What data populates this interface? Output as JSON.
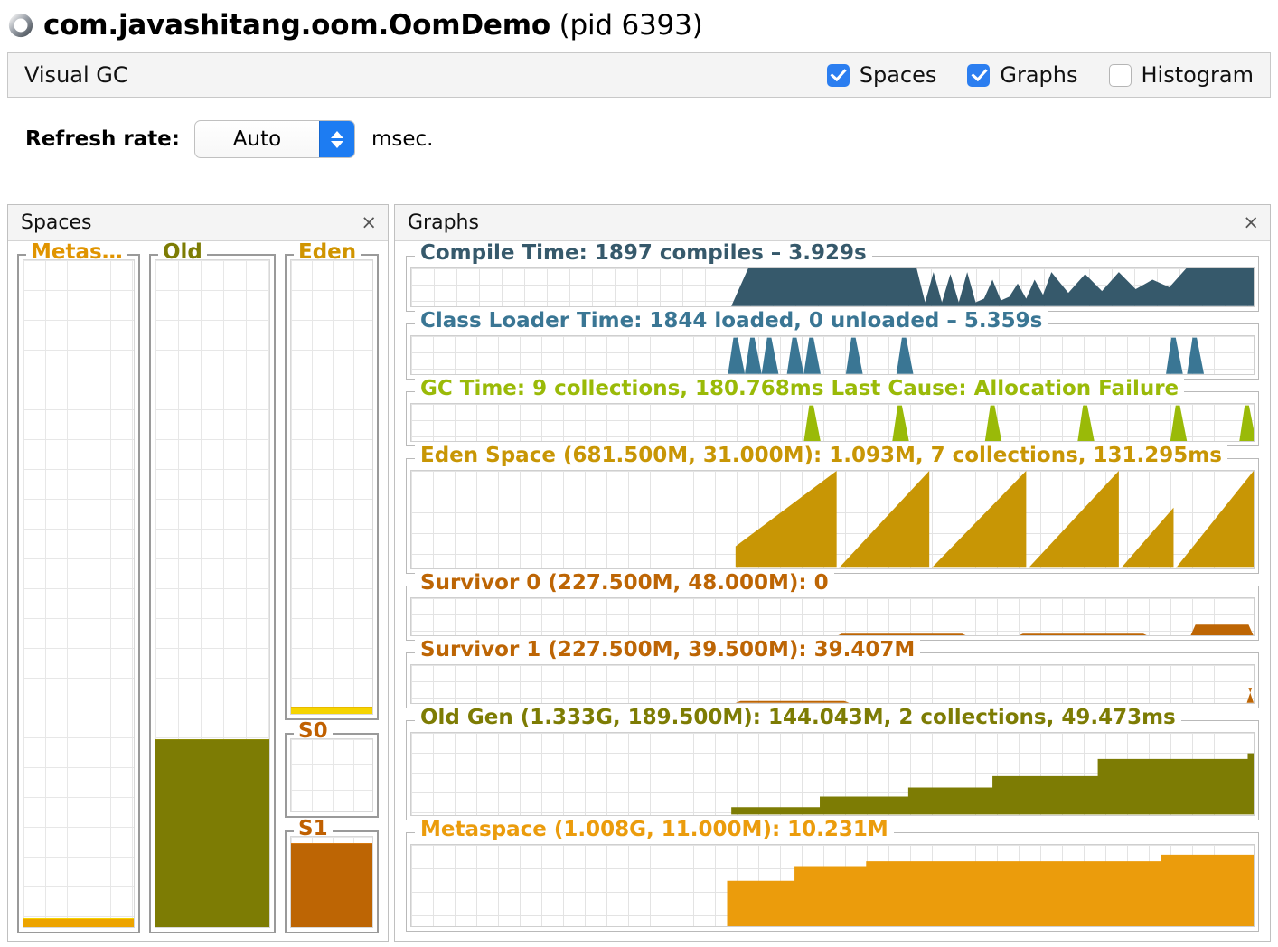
{
  "window": {
    "icon": "loading-spinner-icon",
    "process_name": "com.javashitang.oom.OomDemo",
    "pid_label": "(pid 6393)"
  },
  "tabs": {
    "active_label": "Visual GC",
    "checkboxes": [
      {
        "label": "Spaces",
        "checked": true
      },
      {
        "label": "Graphs",
        "checked": true
      },
      {
        "label": "Histogram",
        "checked": false
      }
    ]
  },
  "refresh": {
    "label": "Refresh rate:",
    "value": "Auto",
    "unit": "msec."
  },
  "spaces_panel": {
    "title": "Spaces",
    "close": "×",
    "regions": [
      {
        "name": "Metas…",
        "color": "#e09400",
        "fill_pct": 1.2,
        "fill_color": "#eda400"
      },
      {
        "name": "Old",
        "color": "#7d7c04",
        "fill_pct": 28.0,
        "fill_color": "#7d7c04"
      },
      {
        "name": "Eden",
        "color": "#d09400",
        "fill_pct": 1.5,
        "fill_color": "#f5d400"
      },
      {
        "name": "S0",
        "color": "#c06000",
        "fill_pct": 0.0,
        "fill_color": "#bd6504"
      },
      {
        "name": "S1",
        "color": "#c06000",
        "fill_pct": 92.0,
        "fill_color": "#bd6504"
      }
    ]
  },
  "graphs_panel": {
    "title": "Graphs",
    "close": "×"
  },
  "chart_data": [
    {
      "type": "area",
      "id": "compile-time",
      "title": "Compile Time: 1897 compiles – 3.929s",
      "color": "#36596b",
      "title_color": "#36596b",
      "metrics": {
        "compiles": 1897,
        "total_time_s": 3.929
      },
      "xlabel": "",
      "ylabel": "",
      "ylim": [
        0,
        1
      ],
      "grid": true,
      "x": [
        0,
        38,
        40,
        42,
        44,
        46,
        48,
        50,
        52,
        54,
        56,
        58,
        60,
        61,
        62,
        63,
        64,
        65,
        66,
        67,
        68,
        69,
        70,
        71,
        72,
        73,
        74,
        75,
        76,
        78,
        80,
        82,
        84,
        86,
        88,
        90,
        92,
        94,
        96,
        98,
        100
      ],
      "values": [
        0,
        0,
        1,
        1,
        1,
        1,
        1,
        1,
        1,
        1,
        1,
        1,
        1,
        0.1,
        0.9,
        0.1,
        0.85,
        0.1,
        0.9,
        0.1,
        0.2,
        0.7,
        0.15,
        0.25,
        0.6,
        0.2,
        0.7,
        0.3,
        0.9,
        0.35,
        0.85,
        0.4,
        0.9,
        0.45,
        0.7,
        0.5,
        1,
        1,
        1,
        1,
        1
      ]
    },
    {
      "type": "area",
      "id": "class-loader-time",
      "title": "Class Loader Time: 1844 loaded, 0 unloaded – 5.359s",
      "color": "#3a7694",
      "title_color": "#3a7694",
      "metrics": {
        "loaded": 1844,
        "unloaded": 0,
        "total_time_s": 5.359
      },
      "xlabel": "",
      "ylabel": "",
      "ylim": [
        0,
        1
      ],
      "grid": true,
      "spikes": [
        38.5,
        40.5,
        42.5,
        45.5,
        47.5,
        52.5,
        58.5,
        90.5,
        93.0
      ]
    },
    {
      "type": "area",
      "id": "gc-time",
      "title": "GC Time: 9 collections, 180.768ms Last Cause: Allocation Failure",
      "color": "#9aba08",
      "title_color": "#9aba08",
      "metrics": {
        "collections": 9,
        "total_time_ms": 180.768,
        "last_cause": "Allocation Failure"
      },
      "xlabel": "",
      "ylabel": "",
      "ylim": [
        0,
        1
      ],
      "grid": true,
      "spikes": [
        47.5,
        58.0,
        69.0,
        80.0,
        91.0,
        99.2
      ]
    },
    {
      "type": "area",
      "id": "eden-space",
      "title": "Eden Space (681.500M, 31.000M): 1.093M, 7 collections, 131.295ms",
      "color": "#c89605",
      "title_color": "#c89605",
      "metrics": {
        "capacity": "681.500M",
        "reserved": "31.000M",
        "used": "1.093M",
        "collections": 7,
        "time_ms": 131.295
      },
      "xlabel": "",
      "ylabel": "",
      "ylim": [
        0,
        1
      ],
      "grid": true,
      "sawtooth": [
        {
          "start": 38.5,
          "peak": 50.5,
          "base": 0.22,
          "top": 1.0
        },
        {
          "start": 50.8,
          "peak": 61.5,
          "base": 0.0,
          "top": 1.0
        },
        {
          "start": 61.8,
          "peak": 73.0,
          "base": 0.0,
          "top": 1.0
        },
        {
          "start": 73.3,
          "peak": 84.0,
          "base": 0.0,
          "top": 1.0
        },
        {
          "start": 84.3,
          "peak": 90.5,
          "base": 0.0,
          "top": 0.62
        },
        {
          "start": 90.8,
          "peak": 100.0,
          "base": 0.0,
          "top": 1.0
        }
      ]
    },
    {
      "type": "area",
      "id": "survivor-0",
      "title": "Survivor 0 (227.500M, 48.000M): 0",
      "color": "#bd6504",
      "title_color": "#bd6504",
      "metrics": {
        "capacity": "227.500M",
        "reserved": "48.000M",
        "used": "0"
      },
      "xlabel": "",
      "ylabel": "",
      "ylim": [
        0,
        1
      ],
      "grid": true,
      "plateaus": [
        {
          "start": 50.5,
          "end": 66.0,
          "level": 0.06
        },
        {
          "start": 72.0,
          "end": 87.5,
          "level": 0.06
        },
        {
          "start": 92.5,
          "end": 100.0,
          "level": 0.3
        }
      ]
    },
    {
      "type": "area",
      "id": "survivor-1",
      "title": "Survivor 1 (227.500M, 39.500M): 39.407M",
      "color": "#bd6504",
      "title_color": "#bd6504",
      "metrics": {
        "capacity": "227.500M",
        "reserved": "39.500M",
        "used": "39.407M"
      },
      "xlabel": "",
      "ylabel": "",
      "ylim": [
        0,
        1
      ],
      "grid": true,
      "plateaus": [
        {
          "start": 38.5,
          "end": 52.0,
          "level": 0.05
        },
        {
          "start": 99.2,
          "end": 100.0,
          "level": 0.4
        }
      ]
    },
    {
      "type": "area",
      "id": "old-gen",
      "title": "Old Gen (1.333G, 189.500M): 144.043M, 2 collections, 49.473ms",
      "color": "#7d7c04",
      "title_color": "#7d7c04",
      "metrics": {
        "capacity": "1.333G",
        "reserved": "189.500M",
        "used": "144.043M",
        "collections": 2,
        "time_ms": 49.473
      },
      "xlabel": "",
      "ylabel": "",
      "ylim": [
        0,
        1
      ],
      "grid": true,
      "steps": [
        {
          "start": 38.0,
          "end": 48.5,
          "level": 0.09
        },
        {
          "start": 48.5,
          "end": 59.0,
          "level": 0.22
        },
        {
          "start": 59.0,
          "end": 69.0,
          "level": 0.33
        },
        {
          "start": 69.0,
          "end": 81.5,
          "level": 0.47
        },
        {
          "start": 81.5,
          "end": 99.3,
          "level": 0.68
        },
        {
          "start": 99.3,
          "end": 100.0,
          "level": 0.75
        }
      ]
    },
    {
      "type": "area",
      "id": "metaspace",
      "title": "Metaspace (1.008G, 11.000M): 10.231M",
      "color": "#eb9c0c",
      "title_color": "#eb9c0c",
      "metrics": {
        "capacity": "1.008G",
        "reserved": "11.000M",
        "used": "10.231M"
      },
      "xlabel": "",
      "ylabel": "",
      "ylim": [
        0,
        1
      ],
      "grid": true,
      "steps": [
        {
          "start": 37.5,
          "end": 45.5,
          "level": 0.56
        },
        {
          "start": 45.5,
          "end": 54.0,
          "level": 0.74
        },
        {
          "start": 54.0,
          "end": 89.0,
          "level": 0.8
        },
        {
          "start": 89.0,
          "end": 100.0,
          "level": 0.88
        }
      ]
    }
  ]
}
